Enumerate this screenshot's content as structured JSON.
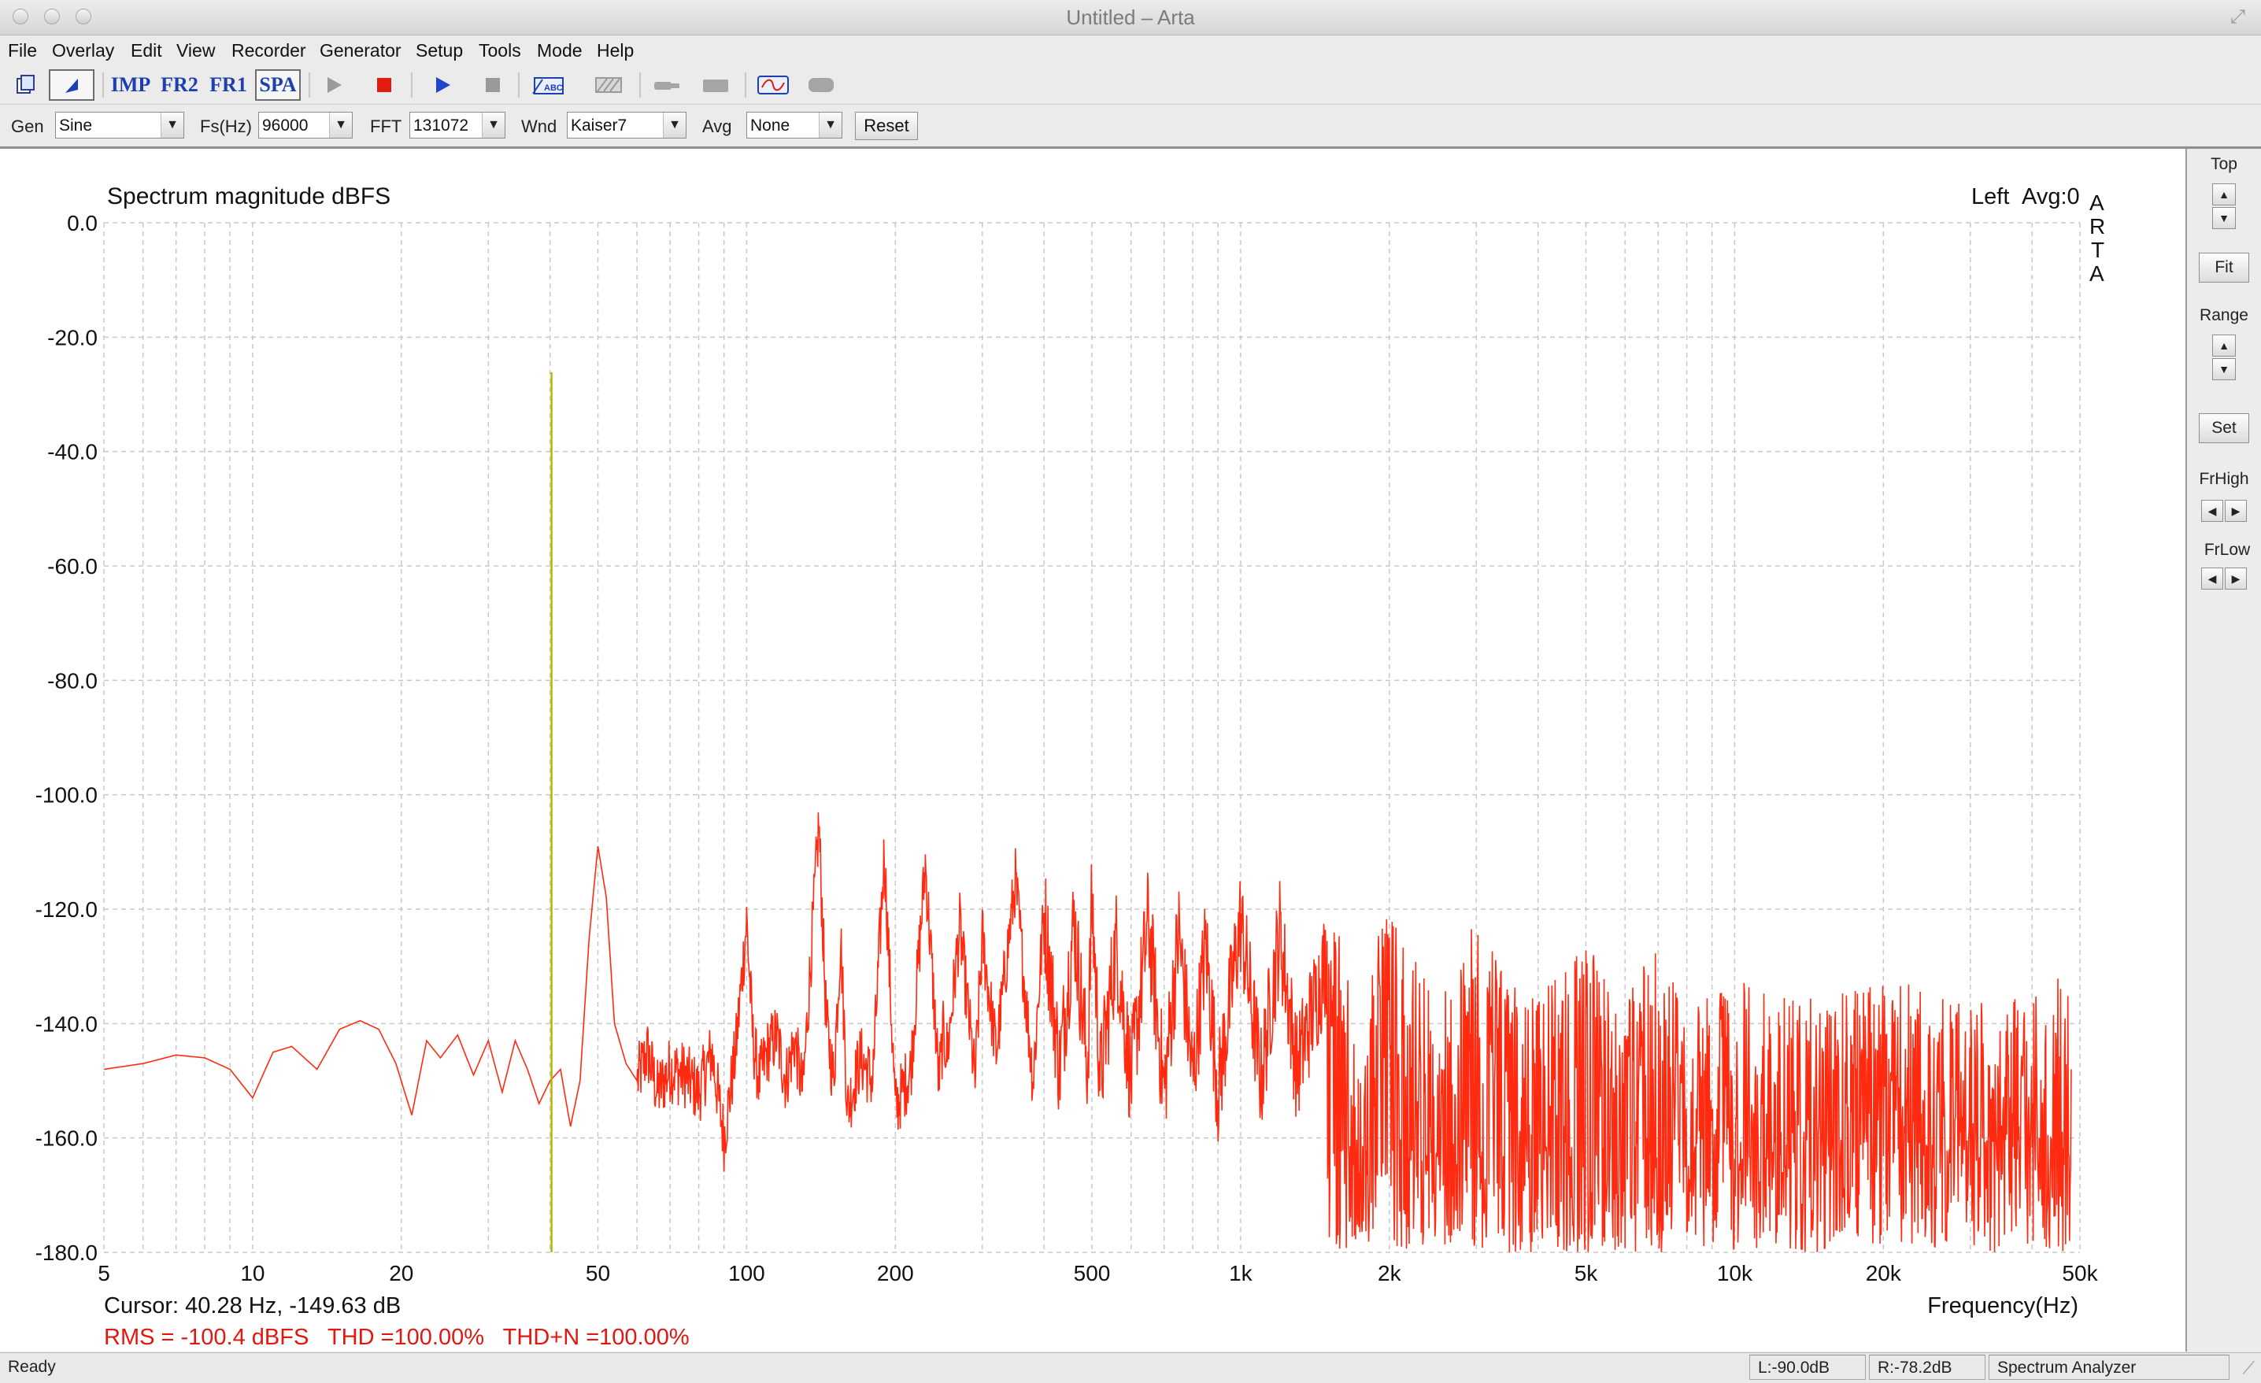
{
  "window": {
    "title": "Untitled – Arta"
  },
  "menu": [
    "File",
    "Overlay",
    "Edit",
    "View",
    "Recorder",
    "Generator",
    "Setup",
    "Tools",
    "Mode",
    "Help"
  ],
  "toolbar": {
    "imp_label": "IMP",
    "fr2_label": "FR2",
    "fr1_label": "FR1",
    "spa_label": "SPA"
  },
  "params": {
    "gen_label": "Gen",
    "gen_value": "Sine",
    "fs_label": "Fs(Hz)",
    "fs_value": "96000",
    "fft_label": "FFT",
    "fft_value": "131072",
    "wnd_label": "Wnd",
    "wnd_value": "Kaiser7",
    "avg_label": "Avg",
    "avg_value": "None",
    "reset_label": "Reset"
  },
  "side": {
    "top_label": "Top",
    "fit_label": "Fit",
    "range_label": "Range",
    "set_label": "Set",
    "frhigh_label": "FrHigh",
    "frlow_label": "FrLow"
  },
  "plot": {
    "channel": "Left",
    "avg": "Avg:0",
    "watermark": "A R T A",
    "cursor": "Cursor: 40.28 Hz, -149.63 dB",
    "stats": "RMS = -100.4 dBFS   THD =100.00%   THD+N =100.00%"
  },
  "status": {
    "ready": "Ready",
    "left_level": "L:-90.0dB",
    "right_level": "R:-78.2dB",
    "mode": "Spectrum Analyzer"
  },
  "colors": {
    "trace": "#ff2a10",
    "cursor": "#b8b800",
    "grid": "#c8c8c8"
  },
  "chart_data": {
    "type": "line",
    "title": "Spectrum magnitude dBFS",
    "xlabel": "Frequency(Hz)",
    "ylabel": "",
    "xscale": "log",
    "xlim": [
      5,
      50000
    ],
    "ylim": [
      -180,
      0
    ],
    "xticks": [
      5,
      10,
      20,
      50,
      100,
      200,
      500,
      1000,
      2000,
      5000,
      10000,
      20000,
      50000
    ],
    "xtick_labels": [
      "5",
      "10",
      "20",
      "50",
      "100",
      "200",
      "500",
      "1k",
      "2k",
      "5k",
      "10k",
      "20k",
      "50k"
    ],
    "yticks": [
      0,
      -20,
      -40,
      -60,
      -80,
      -100,
      -120,
      -140,
      -160,
      -180
    ],
    "ytick_labels": [
      "0.0",
      "-20.0",
      "-40.0",
      "-60.0",
      "-80.0",
      "-100.0",
      "-120.0",
      "-140.0",
      "-160.0",
      "-180.0"
    ],
    "grid": true,
    "cursor_x": 40.28,
    "series": [
      {
        "color": "#ff2a10",
        "x": [
          5,
          6,
          7,
          8,
          9,
          10,
          11,
          12,
          13.5,
          15,
          16.5,
          18,
          19.5,
          21,
          22.5,
          24,
          26,
          28,
          30,
          32,
          34,
          36,
          38,
          40,
          42,
          44,
          46,
          48,
          50,
          52,
          54,
          57,
          60,
          63,
          66,
          70,
          75,
          80,
          85,
          90,
          95,
          100,
          103,
          106,
          110,
          115,
          120,
          125,
          130,
          140,
          145,
          150,
          155,
          160,
          170,
          180,
          190,
          200,
          215,
          230,
          245,
          250,
          255,
          270,
          290,
          300,
          320,
          350,
          380,
          400,
          430,
          460,
          490,
          500,
          520,
          560,
          600,
          650,
          700,
          750,
          800,
          850,
          900,
          1000,
          1100,
          1200,
          1300,
          1500,
          1700,
          2000,
          2500,
          3000,
          4000,
          5000,
          6000,
          7000,
          8000,
          10000,
          12000,
          15000,
          20000,
          25000,
          30000,
          35000,
          40000,
          45000,
          48000
        ],
        "y": [
          -148,
          -147,
          -145.5,
          -146,
          -148,
          -153,
          -145,
          -144,
          -148,
          -141,
          -139.5,
          -141,
          -147,
          -156,
          -143,
          -146,
          -142,
          -149,
          -143,
          -152,
          -143,
          -148,
          -154,
          -150,
          -148,
          -158,
          -150,
          -125,
          -109,
          -118,
          -140,
          -147,
          -150,
          -145,
          -152,
          -148,
          -149,
          -152,
          -145,
          -160,
          -145,
          -122,
          -143,
          -150,
          -145,
          -142,
          -150,
          -143,
          -152,
          -105,
          -140,
          -150,
          -125,
          -155,
          -146,
          -150,
          -110,
          -155,
          -148,
          -112,
          -150,
          -142,
          -145,
          -123,
          -150,
          -125,
          -145,
          -115,
          -150,
          -120,
          -148,
          -122,
          -148,
          -118,
          -150,
          -126,
          -150,
          -122,
          -152,
          -124,
          -150,
          -126,
          -152,
          -122,
          -150,
          -124,
          -148,
          -128,
          -152,
          -132,
          -150,
          -135,
          -149,
          -140,
          -147,
          -140,
          -152,
          -145,
          -148,
          -150,
          -146,
          -148,
          -150,
          -147,
          -149,
          -146,
          -148
        ]
      }
    ]
  }
}
